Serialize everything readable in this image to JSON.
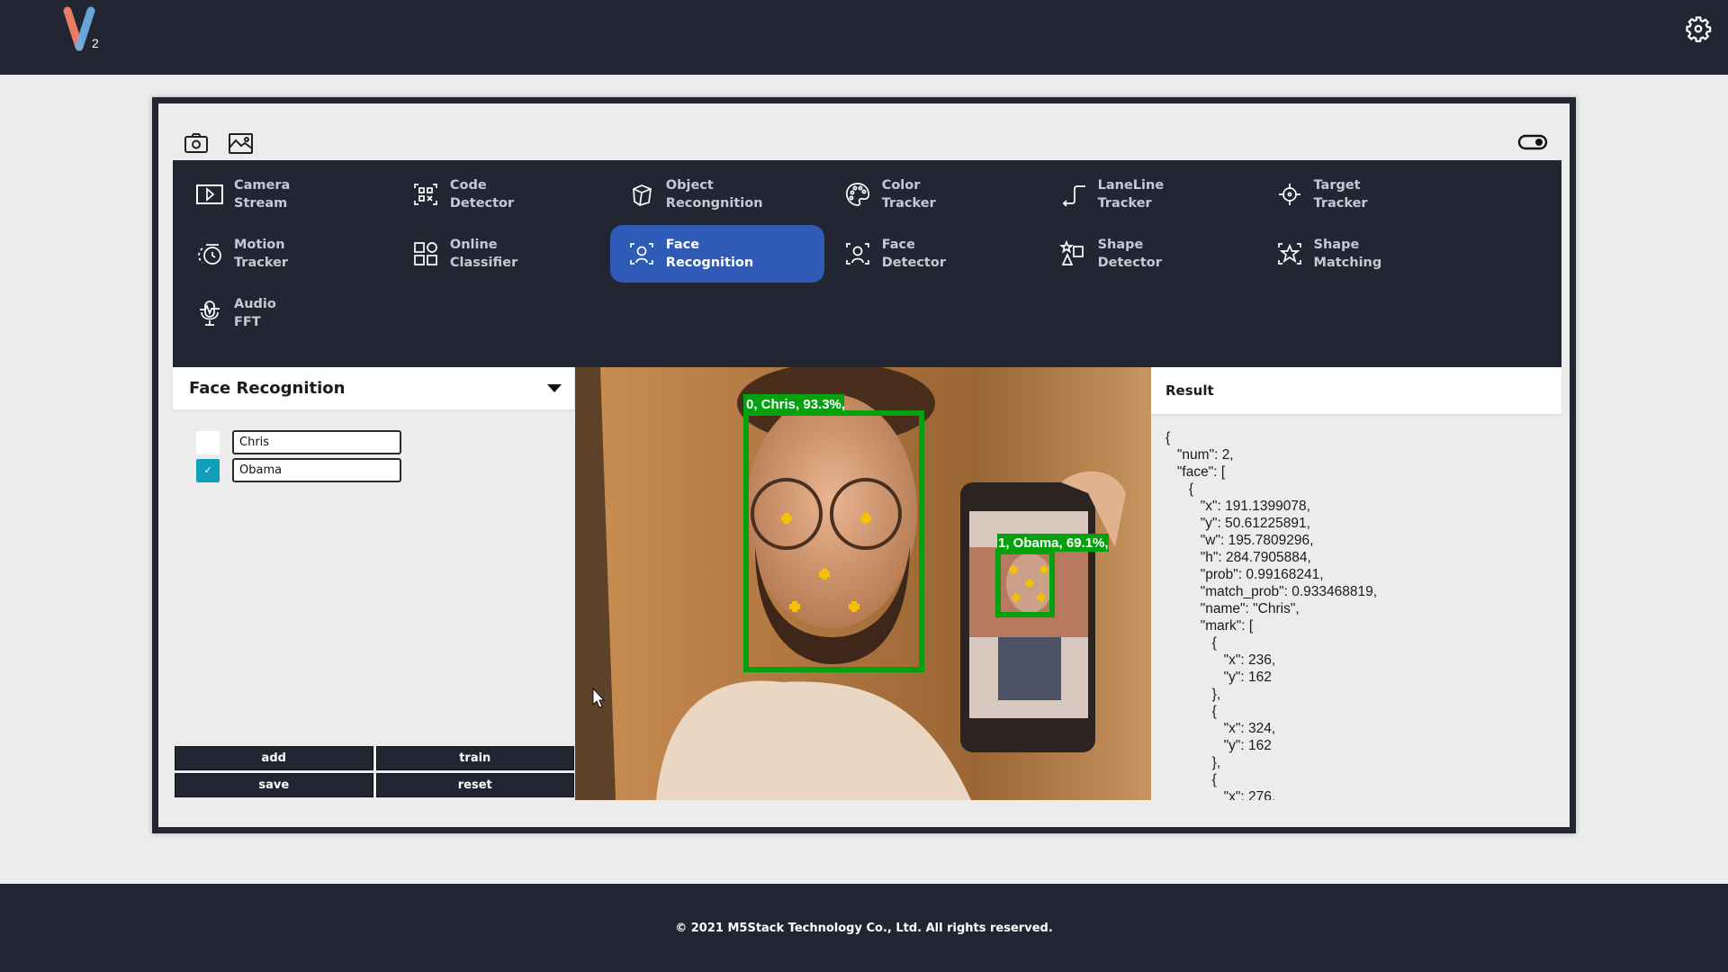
{
  "app": {
    "logo_text": "V",
    "logo_subscript": "2",
    "logo_colors": {
      "left": "#ec7b63",
      "right": "#6fb3e6"
    }
  },
  "colors": {
    "header_bg": "#222632",
    "active_tab": "#2f5bb6",
    "checkbox_checked": "#109fb8",
    "detection_box": "#03a10e",
    "landmark": "#f6c200"
  },
  "toolbar": {
    "camera_icon": "camera-icon",
    "image_icon": "image-icon",
    "toggle_icon": "toggle-icon",
    "toggle_state": "on"
  },
  "menu": {
    "items": [
      {
        "label": "Camera\nStream",
        "icon": "camera-stream-icon",
        "active": false
      },
      {
        "label": "Code\nDetector",
        "icon": "qr-code-icon",
        "active": false
      },
      {
        "label": "Object\nRecongnition",
        "icon": "cube-icon",
        "active": false
      },
      {
        "label": "Color\nTracker",
        "icon": "palette-icon",
        "active": false
      },
      {
        "label": "LaneLine\nTracker",
        "icon": "laneline-icon",
        "active": false
      },
      {
        "label": "Target\nTracker",
        "icon": "crosshair-icon",
        "active": false
      },
      {
        "label": "Motion\nTracker",
        "icon": "motion-icon",
        "active": false
      },
      {
        "label": "Online\nClassifier",
        "icon": "grid-icon",
        "active": false
      },
      {
        "label": "Face\nRecognition",
        "icon": "face-recognition-icon",
        "active": true
      },
      {
        "label": "Face\nDetector",
        "icon": "face-detector-icon",
        "active": false
      },
      {
        "label": "Shape\nDetector",
        "icon": "shapes-icon",
        "active": false
      },
      {
        "label": "Shape\nMatching",
        "icon": "star-frame-icon",
        "active": false
      },
      {
        "label": "Audio\nFFT",
        "icon": "microphone-icon",
        "active": false
      }
    ]
  },
  "face_panel": {
    "title": "Face Recognition",
    "faces": [
      {
        "name": "Chris",
        "checked": false,
        "check_mark": ""
      },
      {
        "name": "Obama",
        "checked": true,
        "check_mark": "✓"
      }
    ],
    "buttons": {
      "add": "add",
      "train": "train",
      "save": "save",
      "reset": "reset"
    }
  },
  "camera": {
    "detections": [
      {
        "label": "0, Chris, 93.3%,"
      },
      {
        "label": "1, Obama, 69.1%,"
      }
    ]
  },
  "result": {
    "title": "Result",
    "text": "{\n   \"num\": 2,\n   \"face\": [\n      {\n         \"x\": 191.1399078,\n         \"y\": 50.61225891,\n         \"w\": 195.7809296,\n         \"h\": 284.7905884,\n         \"prob\": 0.99168241,\n         \"match_prob\": 0.933468819,\n         \"name\": \"Chris\",\n         \"mark\": [\n            {\n               \"x\": 236,\n               \"y\": 162\n            },\n            {\n               \"x\": 324,\n               \"y\": 162\n            },\n            {\n               \"x\": 276,"
  },
  "footer": {
    "copyright": "© 2021 M5Stack Technology Co., Ltd. All rights reserved."
  }
}
